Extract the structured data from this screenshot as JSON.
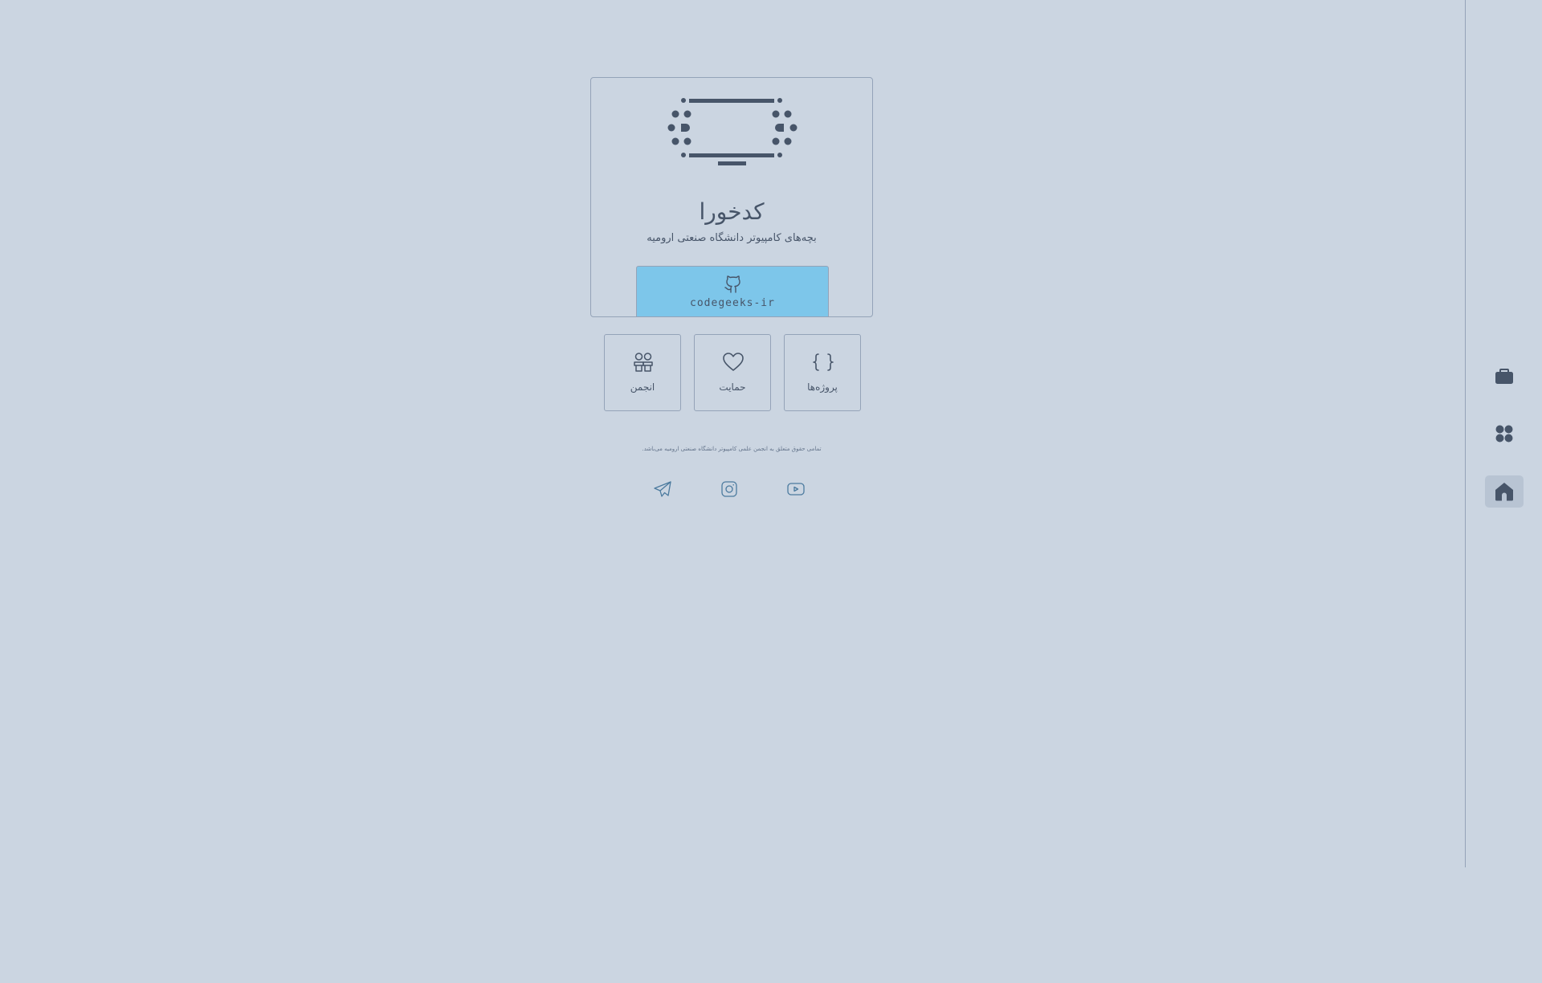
{
  "sidebar": {
    "items": [
      {
        "icon": "briefcase-icon",
        "active": false
      },
      {
        "icon": "apps-grid-icon",
        "active": false
      },
      {
        "icon": "home-icon",
        "active": true
      }
    ]
  },
  "card": {
    "logo_icon": "tv-logo-icon",
    "title": "کدخورا",
    "subtitle": "بچه‌های کامپیوتر دانشگاه صنعتی ارومیه",
    "github": {
      "icon": "github-icon",
      "label": "codegeeks-ir"
    }
  },
  "tiles": [
    {
      "label": "پروژه‌ها",
      "icon": "braces-icon"
    },
    {
      "label": "حمایت",
      "icon": "heart-icon"
    },
    {
      "label": "انجمن",
      "icon": "users-icon"
    }
  ],
  "footer": {
    "copyright": "تمامی حقوق متعلق به انجمن علمی کامپیوتر دانشگاه صنعتی ارومیه می‌باشد.",
    "social": [
      {
        "icon": "youtube-icon"
      },
      {
        "icon": "instagram-icon"
      },
      {
        "icon": "telegram-icon"
      }
    ]
  },
  "colors": {
    "background": "#cbd5e1",
    "text": "#475569",
    "accent": "#7dc6ea",
    "social": "#4b7a9e"
  }
}
